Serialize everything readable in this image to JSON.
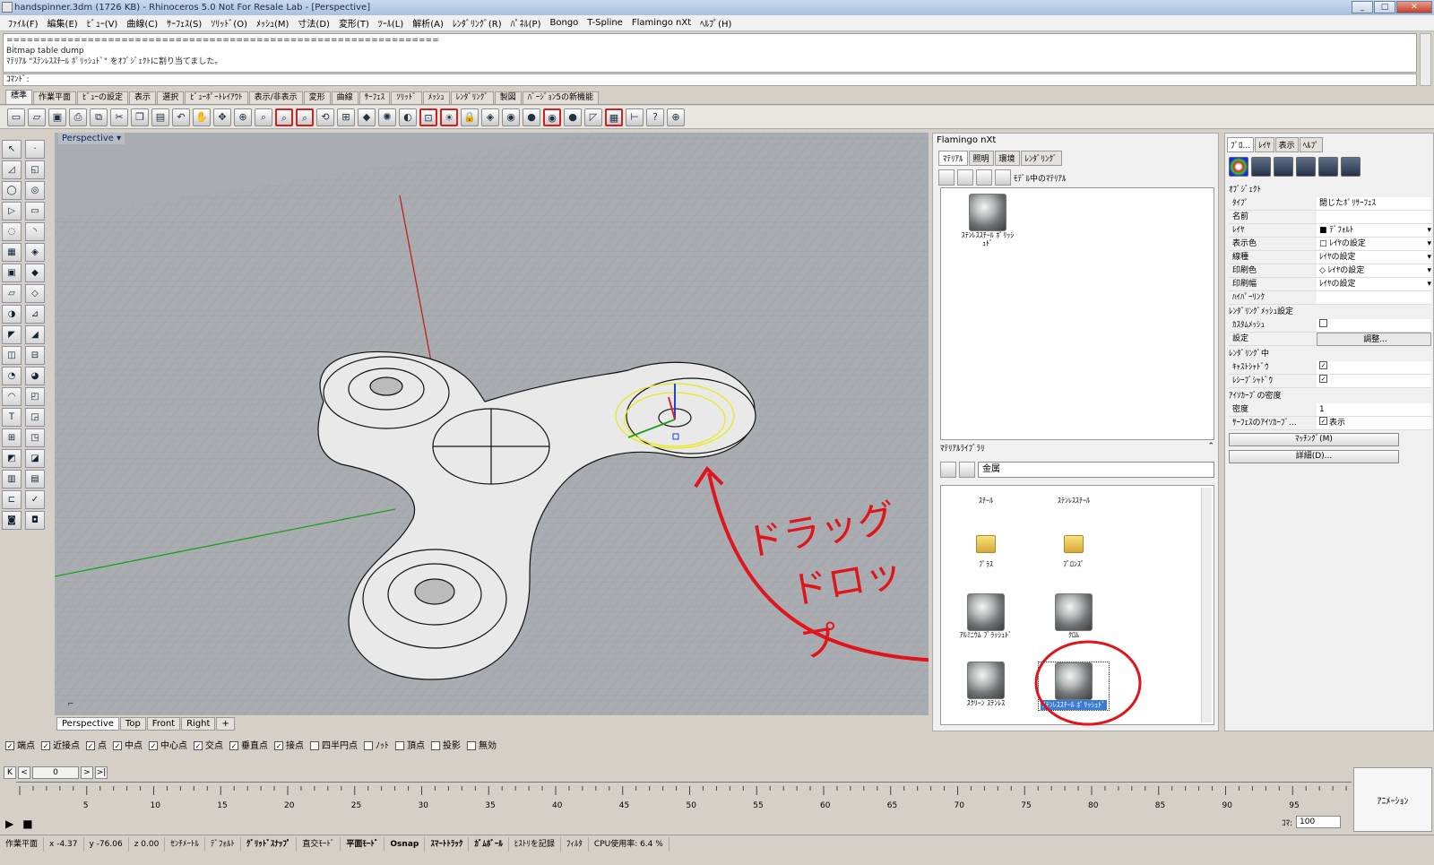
{
  "window": {
    "title": "handspinner.3dm (1726 KB) - Rhinoceros 5.0 Not For Resale Lab - [Perspective]"
  },
  "menu": [
    "ﾌｧｲﾙ(F)",
    "編集(E)",
    "ﾋﾞｭｰ(V)",
    "曲線(C)",
    "ｻｰﾌｪｽ(S)",
    "ｿﾘｯﾄﾞ(O)",
    "ﾒｯｼｭ(M)",
    "寸法(D)",
    "変形(T)",
    "ﾂｰﾙ(L)",
    "解析(A)",
    "ﾚﾝﾀﾞﾘﾝｸﾞ(R)",
    "ﾊﾟﾈﾙ(P)",
    "Bongo",
    "T-Spline",
    "Flamingo nXt",
    "ﾍﾙﾌﾟ(H)"
  ],
  "command": {
    "history": [
      "================================================================",
      "Bitmap table dump",
      "ﾏﾃﾘｱﾙ \"ｽﾃﾝﾚｽｽﾁｰﾙ ﾎﾟﾘｯｼｭﾄﾞ\" をｵﾌﾞｼﾞｪｸﾄに割り当てました。"
    ],
    "prompt": "ｺﾏﾝﾄﾞ:"
  },
  "toolbar_tabs": [
    "標準",
    "作業平面",
    "ﾋﾞｭｰの設定",
    "表示",
    "選択",
    "ﾋﾞｭｰﾎﾟｰﾄﾚｲｱｳﾄ",
    "表示/非表示",
    "変形",
    "曲線",
    "ｻｰﾌｪｽ",
    "ｿﾘｯﾄﾞ",
    "ﾒｯｼｭ",
    "ﾚﾝﾀﾞﾘﾝｸﾞ",
    "製図",
    "ﾊﾞｰｼﾞｮﾝ5の新機能"
  ],
  "viewport": {
    "label": "Perspective",
    "tabs": [
      "Perspective",
      "Top",
      "Front",
      "Right"
    ],
    "annotation": [
      "ドラッグ",
      "ドロップ"
    ]
  },
  "osnap": [
    {
      "label": "端点",
      "checked": true
    },
    {
      "label": "近接点",
      "checked": true
    },
    {
      "label": "点",
      "checked": true
    },
    {
      "label": "中点",
      "checked": true
    },
    {
      "label": "中心点",
      "checked": true
    },
    {
      "label": "交点",
      "checked": true
    },
    {
      "label": "垂直点",
      "checked": true
    },
    {
      "label": "接点",
      "checked": true
    },
    {
      "label": "四半円点",
      "checked": false
    },
    {
      "label": "ﾉｯﾄ",
      "checked": false
    },
    {
      "label": "頂点",
      "checked": false
    },
    {
      "label": "投影",
      "checked": false
    },
    {
      "label": "無効",
      "checked": false
    }
  ],
  "timeline": {
    "frame": "0",
    "ticks": [
      "5",
      "10",
      "15",
      "20",
      "25",
      "30",
      "35",
      "40",
      "45",
      "50",
      "55",
      "60",
      "65",
      "70",
      "75",
      "80",
      "85",
      "90",
      "95"
    ],
    "animation_label": "ｱﾆﾒｰｼｮﾝ",
    "koma_label": "ｺﾏ:",
    "koma_value": "100"
  },
  "status": [
    "作業平面",
    "x -4.37",
    "y -76.06",
    "z 0.00",
    "ｾﾝﾁﾒｰﾄﾙ",
    "ﾃﾞﾌｫﾙﾄ",
    "ｸﾞﾘｯﾄﾞｽﾅｯﾌﾟ",
    "直交ﾓｰﾄﾞ",
    "平面ﾓｰﾄﾞ",
    "Osnap",
    "ｽﾏｰﾄﾄﾗｯｸ",
    "ｶﾞﾑﾎﾞｰﾙ",
    "ﾋｽﾄﾘを記録",
    "ﾌｨﾙﾀ",
    "CPU使用率: 6.4 %"
  ],
  "flamingo": {
    "title": "Flamingo nXt",
    "tabs": [
      "ﾏﾃﾘｱﾙ",
      "照明",
      "環境",
      "ﾚﾝﾀﾞﾘﾝｸﾞ"
    ],
    "model_materials_label": "ﾓﾃﾞﾙ中のﾏﾃﾘｱﾙ",
    "model_material": "ｽﾃﾝﾚｽｽﾁｰﾙ ﾎﾟﾘｯｼｭﾄﾞ",
    "library_header": "ﾏﾃﾘｱﾙﾗｲﾌﾞﾗﾘ",
    "library_folder": "金属",
    "library_items": [
      "ｽﾁｰﾙ",
      "ｽﾃﾝﾚｽｽﾁｰﾙ",
      "ﾌﾞﾗｽ",
      "ﾌﾞﾛﾝｽﾞ",
      "ｱﾙﾐﾆｳﾑ ﾌﾞﾗｯｼｭﾄﾞ",
      "ｸﾛﾑ",
      "ｽｸﾘｰﾝ ｽﾃﾝﾚｽ",
      "ｽﾃﾝﾚｽｽﾁｰﾙ ﾎﾟﾘｯｼｭﾄﾞ"
    ]
  },
  "properties": {
    "tabs": [
      "ﾌﾟﾛ...",
      "ﾚｲﾔ",
      "表示",
      "ﾍﾙﾌﾟ"
    ],
    "object_section": "ｵﾌﾞｼﾞｪｸﾄ",
    "rows": [
      {
        "k": "ﾀｲﾌﾟ",
        "v": "閉じたﾎﾟﾘｻｰﾌｪｽ"
      },
      {
        "k": "名前",
        "v": ""
      },
      {
        "k": "ﾚｲﾔ",
        "v": "■ ﾃﾞﾌｫﾙﾄ"
      },
      {
        "k": "表示色",
        "v": "□ ﾚｲﾔの設定"
      },
      {
        "k": "線種",
        "v": "ﾚｲﾔの設定"
      },
      {
        "k": "印刷色",
        "v": "◇ ﾚｲﾔの設定"
      },
      {
        "k": "印刷幅",
        "v": "ﾚｲﾔの設定"
      },
      {
        "k": "ﾊｲﾊﾟｰﾘﾝｸ",
        "v": ""
      }
    ],
    "mesh_section": "ﾚﾝﾀﾞﾘﾝｸﾞﾒｯｼｭ設定",
    "custom_mesh": "ｶｽﾀﾑﾒｯｼｭ",
    "settings": "設定",
    "adjust": "調整...",
    "render_section": "ﾚﾝﾀﾞﾘﾝｸﾞ中",
    "cast_shadow": "ｷｬｽﾄｼｬﾄﾞｳ",
    "receive_shadow": "ﾚｼｰﾌﾞｼｬﾄﾞｳ",
    "iso_section": "ｱｲｿｶｰﾌﾞの密度",
    "density": "密度",
    "density_value": "1",
    "iso_show": "ｻｰﾌｪｽのｱｲｿｶｰﾌﾞ...",
    "show": "表示",
    "match_btn": "ﾏｯﾁﾝｸﾞ(M)",
    "detail_btn": "詳細(D)..."
  },
  "colors": {
    "annotation_red": "#e0141b",
    "viewport_bg": "#a9adb2",
    "select_blue": "#3b7bd6"
  }
}
